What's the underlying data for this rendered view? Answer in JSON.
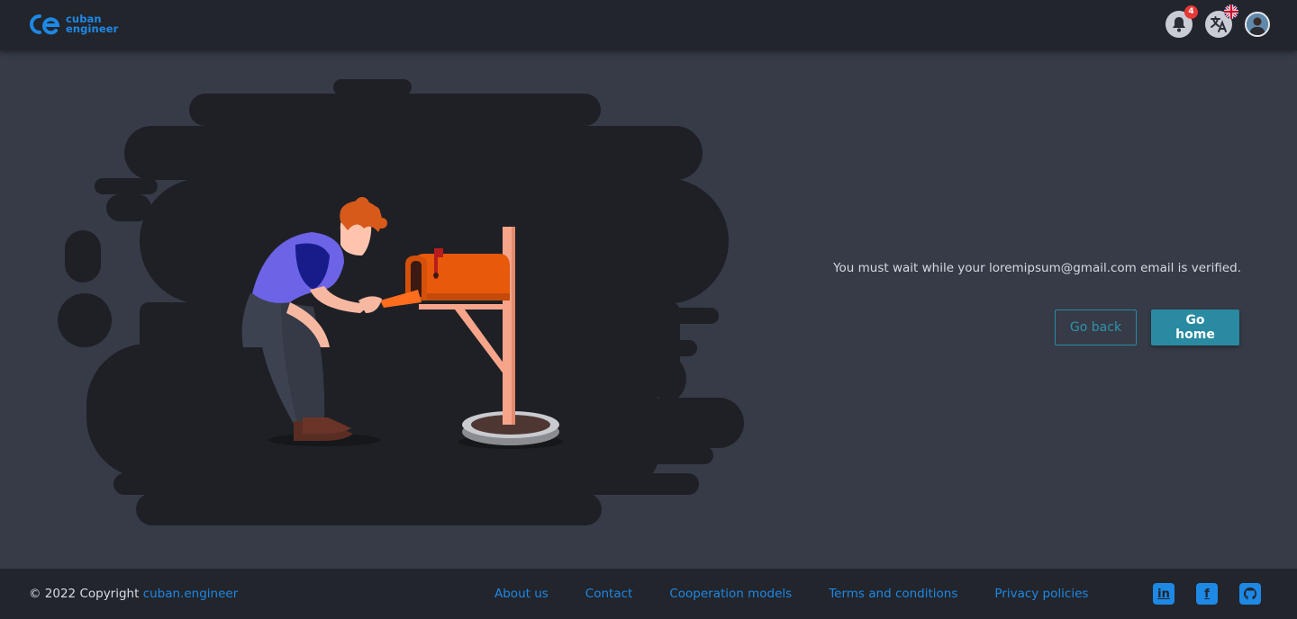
{
  "header": {
    "logo": {
      "line1": "cuban",
      "line2": "engineer"
    },
    "notifications": {
      "count": "4",
      "icon": "bell-icon"
    },
    "language": {
      "icon": "translate-icon",
      "flag": "uk-flag-icon"
    },
    "user": {
      "icon": "avatar"
    }
  },
  "main": {
    "message": "You must wait while your loremipsum@gmail.com email is verified.",
    "back_label": "Go back",
    "home_label": "Go home"
  },
  "footer": {
    "copyright_prefix": "© 2022 Copyright",
    "copyright_link": "cuban.engineer",
    "links": [
      "About us",
      "Contact",
      "Cooperation models",
      "Terms and conditions",
      "Privacy policies"
    ],
    "socials": [
      "linkedin-icon",
      "facebook-icon",
      "github-icon"
    ]
  },
  "colors": {
    "background": "#363b47",
    "bar": "#22252c",
    "accent": "#1e88e5",
    "button": "#2a8aa2",
    "badge": "#e53935",
    "mailbox": "#e8590c"
  }
}
